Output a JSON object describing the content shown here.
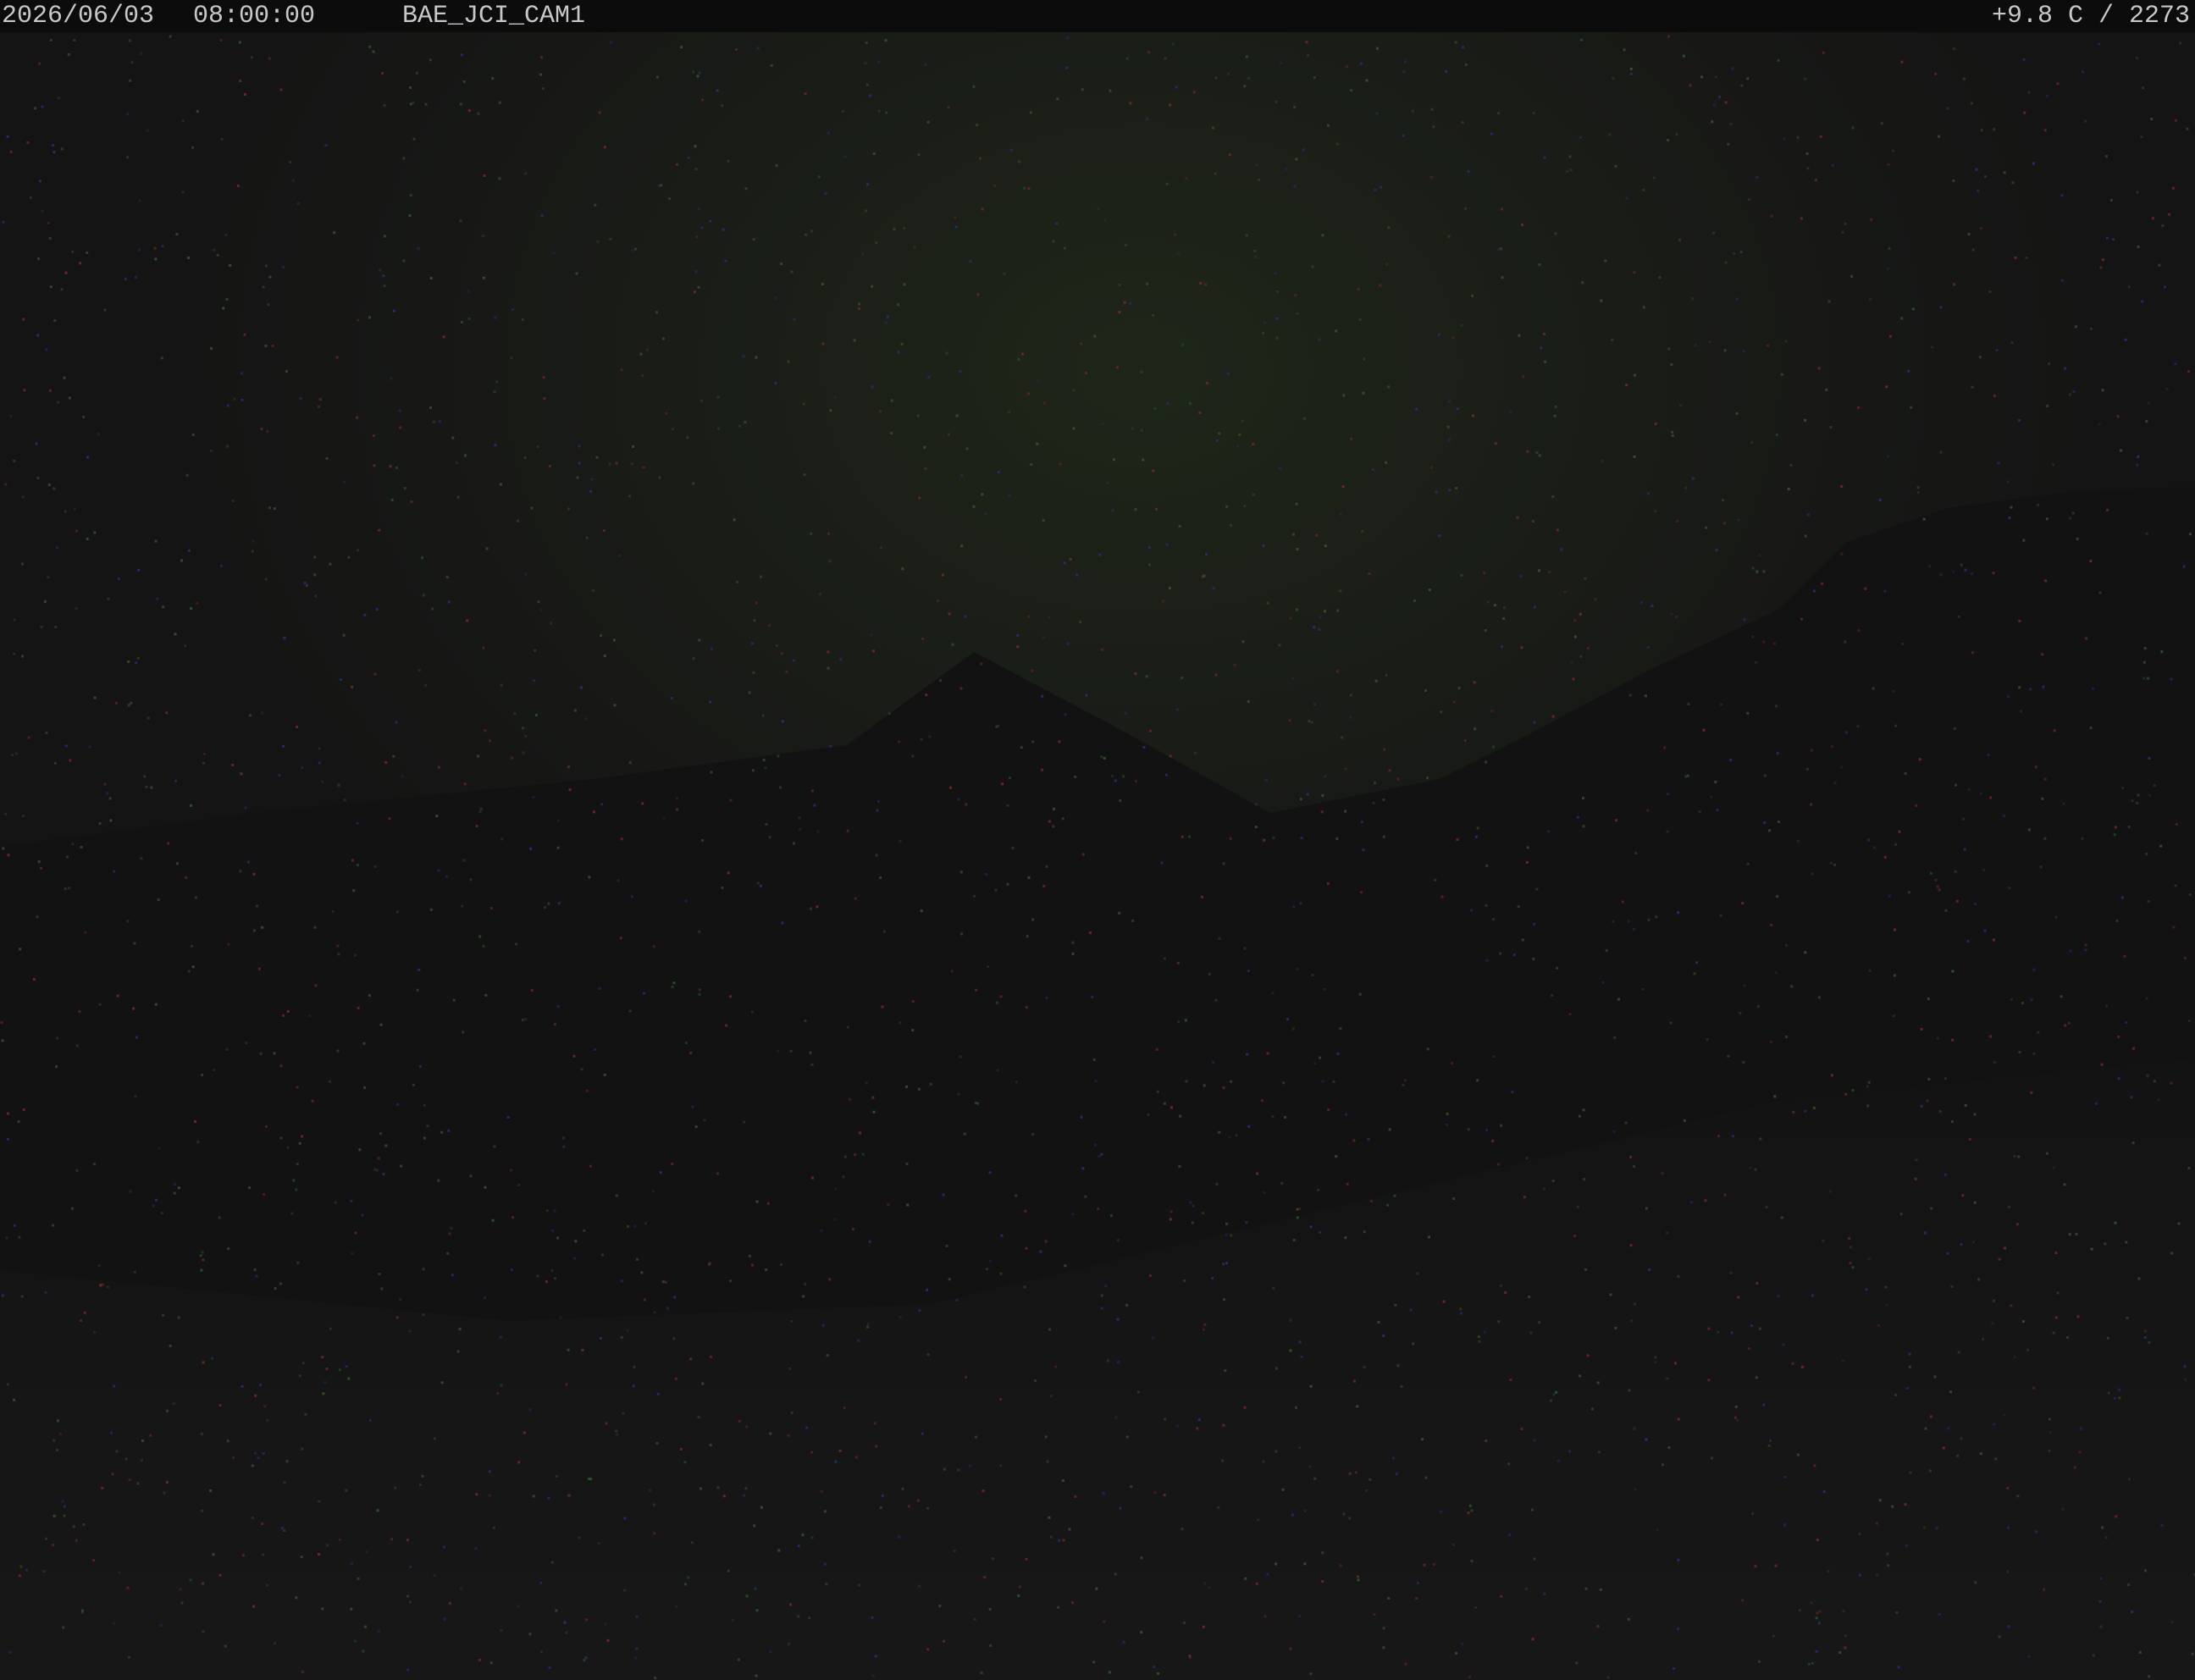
{
  "overlay": {
    "date": "2026/06/03",
    "time": "08:00:00",
    "camera_id": "BAE_JCI_CAM1",
    "readout": "+9.8 C / 2273"
  },
  "scene": {
    "description_colors": {
      "background": "#141414",
      "sky_glow": "#1c2318",
      "mountain": "#121212",
      "noise_red": "#7a2a2a",
      "noise_green": "#2f5a2f",
      "noise_blue": "#2a2f7a"
    }
  }
}
